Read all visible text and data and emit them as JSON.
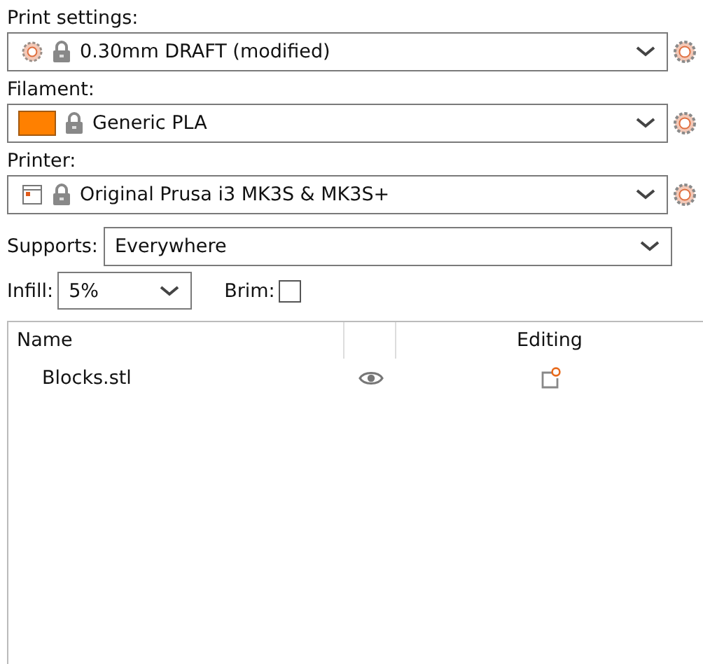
{
  "presets": [
    {
      "label": "Print settings:",
      "kind": "print",
      "value": "0.30mm DRAFT (modified)"
    },
    {
      "label": "Filament:",
      "kind": "filament",
      "value": "Generic PLA",
      "color": "#ff8000"
    },
    {
      "label": "Printer:",
      "kind": "printer",
      "value": "Original Prusa i3 MK3S & MK3S+"
    }
  ],
  "supports": {
    "label": "Supports:",
    "value": "Everywhere"
  },
  "infill": {
    "label": "Infill:",
    "value": "5%"
  },
  "brim": {
    "label": "Brim:",
    "checked": false
  },
  "table": {
    "columns": [
      "Name",
      "Editing"
    ],
    "rows": [
      {
        "name": "Blocks.stl",
        "visible": true
      }
    ]
  }
}
